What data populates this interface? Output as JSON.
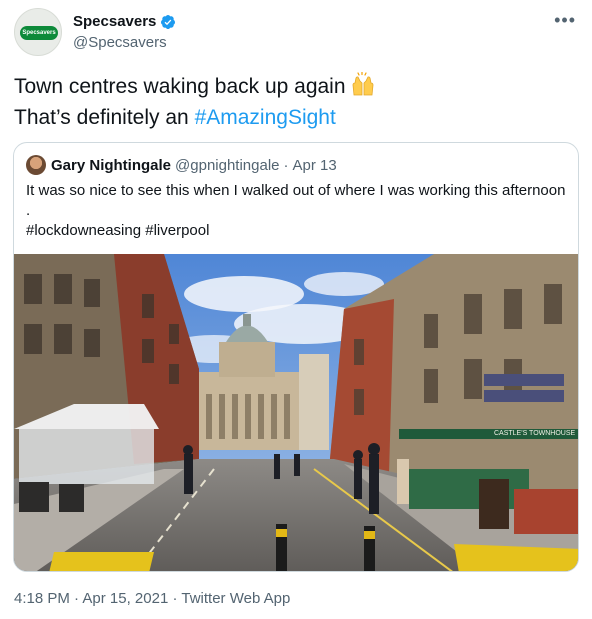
{
  "author": {
    "display_name": "Specsavers",
    "handle": "@Specsavers",
    "avatar_text": "Specsavers",
    "verified": true
  },
  "tweet": {
    "line1": "Town centres waking back up again",
    "line2_prefix": "That’s definitely an ",
    "hashtag": "#AmazingSight"
  },
  "quote": {
    "display_name": "Gary Nightingale",
    "handle": "@gpnightingale",
    "separator": "·",
    "date": "Apr 13",
    "text_line1": "It was so nice to see this when I walked out of where I was working this afternoon",
    "text_line2": ".",
    "hashtag1": "#lockdowneasing",
    "hashtag2": "#liverpool",
    "sign_text": "CASTLE'S TOWNHOUSE"
  },
  "meta": {
    "time": "4:18 PM",
    "separator": "·",
    "date": "Apr 15, 2021",
    "app": "Twitter Web App"
  },
  "icons": {
    "more": "more-icon",
    "verified": "verified-badge-icon",
    "emoji": "raising-hands-icon"
  },
  "colors": {
    "link": "#1d9bf0",
    "brand_green": "#0d8a3a",
    "muted": "#536471"
  }
}
